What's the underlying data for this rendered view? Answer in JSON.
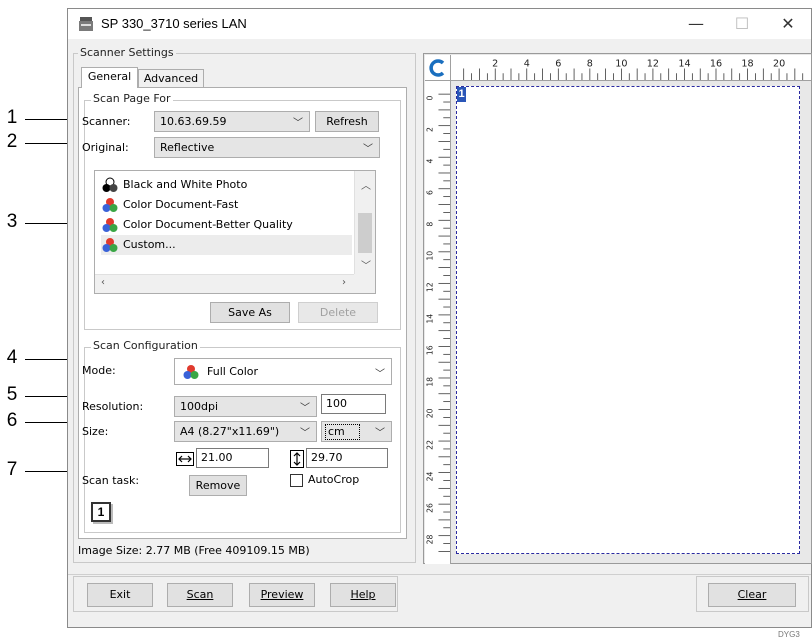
{
  "window": {
    "title": "SP 330_3710 series LAN"
  },
  "window_controls": {
    "minimize": "—",
    "maximize": "☐",
    "close": "✕"
  },
  "callouts": [
    "1",
    "2",
    "3",
    "4",
    "5",
    "6",
    "7"
  ],
  "scanner_settings": {
    "group_label": "Scanner Settings",
    "tabs": [
      "General",
      "Advanced"
    ],
    "scan_page_for": {
      "group_label": "Scan Page For",
      "scanner_label": "Scanner:",
      "scanner_value": "10.63.69.59",
      "refresh_label": "Refresh",
      "original_label": "Original:",
      "original_value": "Reflective",
      "list_items": [
        {
          "label": "Black and White Photo",
          "icon": "bw-photo-icon"
        },
        {
          "label": "Color Document-Fast",
          "icon": "color-dots-icon"
        },
        {
          "label": "Color Document-Better Quality",
          "icon": "color-dots-icon"
        },
        {
          "label": "Custom...",
          "icon": "color-dots-icon",
          "selected": true
        }
      ],
      "save_as_label": "Save As",
      "delete_label": "Delete"
    },
    "scan_configuration": {
      "group_label": "Scan Configuration",
      "mode_label": "Mode:",
      "mode_value": "Full Color",
      "resolution_label": "Resolution:",
      "resolution_value": "100dpi",
      "resolution_custom": "100",
      "size_label": "Size:",
      "size_value": "A4 (8.27\"x11.69\")",
      "unit_value": "cm",
      "width_value": "21.00",
      "height_value": "29.70",
      "scan_task_label": "Scan task:",
      "remove_label": "Remove",
      "autocrop_label": "AutoCrop",
      "autocrop_checked": false,
      "page_number": "1"
    },
    "image_size_text": "Image Size: 2.77 MB (Free 409109.15 MB)"
  },
  "preview": {
    "ruler_top_labels": [
      "2",
      "4",
      "6",
      "8",
      "10",
      "12",
      "14",
      "16",
      "18",
      "20"
    ],
    "ruler_left_labels": [
      "0",
      "2",
      "4",
      "6",
      "8",
      "10",
      "12",
      "14",
      "16",
      "18",
      "20",
      "22",
      "24",
      "26",
      "28"
    ],
    "page_marker": "1"
  },
  "footer": {
    "exit_label": "Exit",
    "scan_label": "Scan",
    "preview_label": "Preview",
    "help_label": "Help",
    "clear_label": "Clear"
  },
  "figure_code": "DYG3"
}
